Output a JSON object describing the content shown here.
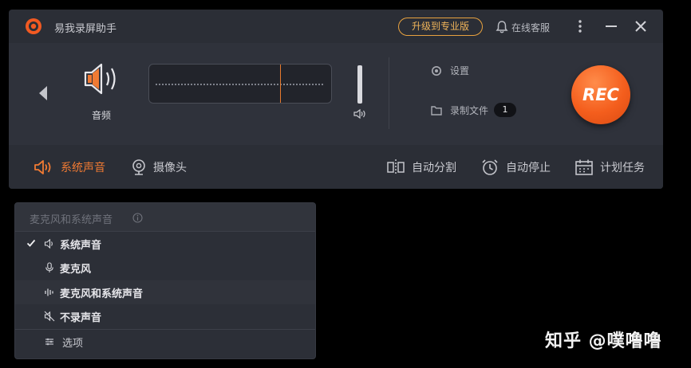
{
  "window": {
    "title": "易我录屏助手",
    "upgrade_label": "升级到专业版",
    "support_label": "在线客服"
  },
  "main": {
    "source_label": "音频",
    "settings_label": "设置",
    "files_label": "录制文件",
    "files_count": "1",
    "rec_label": "REC"
  },
  "toolbar": {
    "system_sound": "系统声音",
    "camera": "摄像头",
    "auto_split": "自动分割",
    "auto_stop": "自动停止",
    "schedule": "计划任务"
  },
  "dropdown": {
    "header": "麦克风和系统声音",
    "items": [
      {
        "label": "系统声音",
        "checked": true
      },
      {
        "label": "麦克风",
        "checked": false
      },
      {
        "label": "麦克风和系统声音",
        "checked": false
      },
      {
        "label": "不录声音",
        "checked": false
      }
    ],
    "options_label": "选项"
  },
  "watermark": "知乎 @噗噜噜",
  "colors": {
    "accent": "#f07a33",
    "rec": "#f45e1d",
    "upgrade": "#e8a23f"
  },
  "icons": [
    "app-logo-icon",
    "bell-icon",
    "more-icon",
    "minimize-icon",
    "close-icon",
    "chevron-left-icon",
    "speaker-icon",
    "volume-icon",
    "gear-icon",
    "folder-icon",
    "webcam-icon",
    "split-icon",
    "alarm-icon",
    "calendar-icon",
    "info-icon",
    "check-icon",
    "microphone-icon",
    "waveform-icon",
    "mute-icon",
    "options-icon"
  ]
}
